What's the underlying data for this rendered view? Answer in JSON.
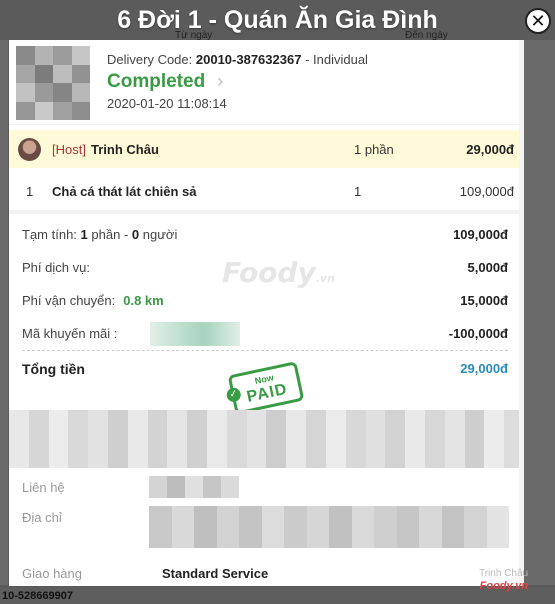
{
  "background": {
    "header_cols": [
      "Từ ngày",
      "Đến ngày"
    ],
    "footer_text": "10-528669907"
  },
  "popup": {
    "title": "6 Đời 1 - Quán Ăn Gia Đình",
    "close_glyph": "✕"
  },
  "order": {
    "delivery_code_label": "Delivery Code:",
    "delivery_code": "20010-387632367",
    "order_type": "- Individual",
    "status": "Completed",
    "status_chevron": "›",
    "datetime": "2020-01-20 11:08:14"
  },
  "host": {
    "tag": "[Host]",
    "name": "Trinh Châu",
    "qty": "1 phần",
    "price": "29,000đ"
  },
  "items": [
    {
      "index": "1",
      "name": "Chả cá thát lát chiên sả",
      "qty": "1",
      "price": "109,000đ"
    }
  ],
  "summary": {
    "subtotal_label_pre": "Tạm tính:",
    "subtotal_portions": "1",
    "subtotal_label_mid": "phần -",
    "subtotal_people": "0",
    "subtotal_label_post": "người",
    "subtotal_value": "109,000đ",
    "service_fee_label": "Phí dịch vụ:",
    "service_fee_value": "5,000đ",
    "shipping_fee_label": "Phí vận chuyển:",
    "shipping_distance": "0.8 km",
    "shipping_fee_value": "15,000đ",
    "promo_label": "Mã khuyến mãi :",
    "promo_value": "-100,000đ",
    "total_label": "Tổng tiền",
    "total_value": "29,000đ"
  },
  "stamp": {
    "line1": "Now",
    "line2": "PAID",
    "check": "✓"
  },
  "watermark": {
    "brand": "Foody",
    "suffix": ".vn"
  },
  "contact": {
    "contact_label": "Liên hệ",
    "address_label": "Địa chỉ",
    "delivery_label": "Giao hàng",
    "delivery_value": "Standard Service"
  },
  "corner_watermark": {
    "name": "Trinh Châu",
    "logo": "Foody.vn"
  },
  "colors": {
    "status_green": "#3a9b45",
    "total_blue": "#2b8bb8",
    "host_bg": "#fffbd8",
    "host_tag_red": "#aa3333"
  }
}
